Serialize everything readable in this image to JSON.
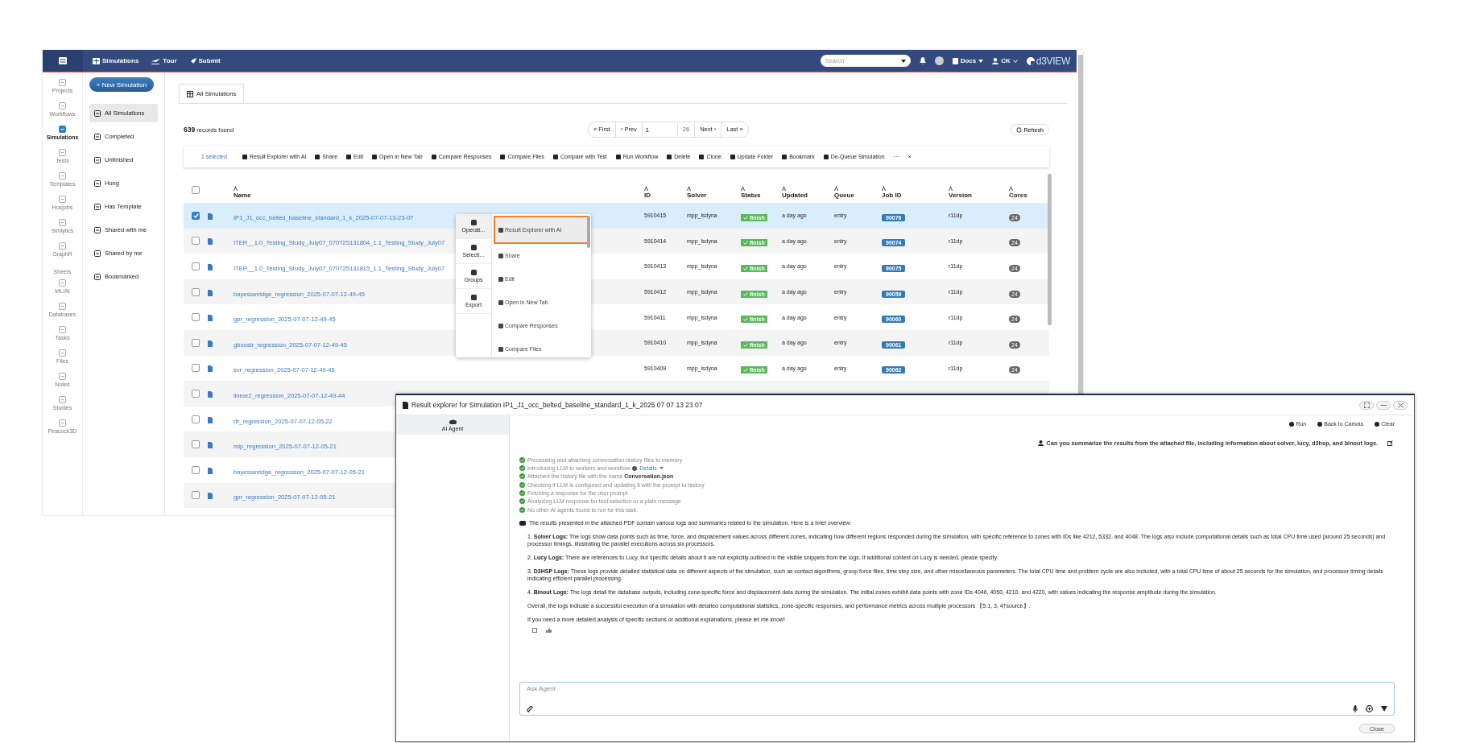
{
  "navbar": {
    "items": [
      {
        "label": "Simulations"
      },
      {
        "label": "Tour"
      },
      {
        "label": "Submit"
      }
    ],
    "search": {
      "placeholder": "Search"
    },
    "docs": "Docs",
    "user": "CK",
    "logo": "d3VIEW"
  },
  "rail": {
    "groups": [
      {
        "items": [
          {
            "label": "Projects",
            "selected": false
          },
          {
            "label": "Workflows",
            "selected": false
          },
          {
            "label": "Simulations",
            "selected": true
          },
          {
            "label": "Tests",
            "selected": false
          },
          {
            "label": "Templates",
            "selected": false
          },
          {
            "label": "Hocjobs",
            "selected": false
          },
          {
            "label": "Simlytics",
            "selected": false
          },
          {
            "label": "GraphR",
            "selected": false
          }
        ]
      },
      {
        "heading": "Sheets",
        "items": [
          {
            "label": "ML/AI",
            "selected": false
          },
          {
            "label": "Databases",
            "selected": false
          },
          {
            "label": "Tasks",
            "selected": false
          },
          {
            "label": "Files",
            "selected": false
          },
          {
            "label": "Notes",
            "selected": false
          },
          {
            "label": "Studies",
            "selected": false
          },
          {
            "label": "Peacock3D",
            "selected": false
          }
        ]
      }
    ]
  },
  "sidebar": {
    "new_button": "+ New Simulation",
    "items": [
      {
        "label": "All Simulations",
        "selected": true
      },
      {
        "label": "Completed",
        "selected": false
      },
      {
        "label": "Unfinished",
        "selected": false
      },
      {
        "label": "Hung",
        "selected": false
      },
      {
        "label": "Has Template",
        "selected": false
      },
      {
        "label": "Shared with me",
        "selected": false
      },
      {
        "label": "Shared by me",
        "selected": false
      },
      {
        "label": "Bookmarked",
        "selected": false
      }
    ]
  },
  "main": {
    "tab": {
      "label": "All Simulations",
      "selected": true
    },
    "records": {
      "count": "639",
      "label": "records found"
    },
    "pagination": {
      "first": "« First",
      "prev": "‹ Prev",
      "page": "1",
      "total": "26",
      "next": "Next ›",
      "last": "Last »"
    },
    "refresh": "Refresh"
  },
  "toolbar": {
    "selected_count": "1 selected",
    "actions": [
      "Result Explorer with AI",
      "Share",
      "Edit",
      "Open in New Tab",
      "Compare Responses",
      "Compare Files",
      "Compare with Test",
      "Run Workflow",
      "Delete",
      "Clone",
      "Update Folder",
      "Bookmark",
      "De-Queue Simulation"
    ],
    "more": "···",
    "close": "×"
  },
  "table": {
    "select_all": {
      "checked": false
    },
    "columns": [
      "Name",
      "ID",
      "Solver",
      "Status",
      "Updated",
      "Queue",
      "Job ID",
      "Version",
      "Cores"
    ],
    "rows": [
      {
        "selected": true,
        "name": "IP1_J1_occ_belted_baseline_standard_1_k_2025-07-07-13-23-07",
        "id": "5910415",
        "solver": "mpp_lsdyna",
        "status": "finish",
        "updated": "a day ago",
        "queue": "entry",
        "job_id": "90076",
        "version": "r11dp",
        "cores": "24"
      },
      {
        "selected": false,
        "name": "ITER__1.0_Testing_Study_July07_070725131804_1.1_Testing_Study_July07",
        "id": "5910414",
        "solver": "mpp_lsdyna",
        "status": "finish",
        "updated": "a day ago",
        "queue": "entry",
        "job_id": "90074",
        "version": "r11dp",
        "cores": "24"
      },
      {
        "selected": false,
        "name": "ITER__1.0_Testing_Study_July07_070725131815_1.1_Testing_Study_July07",
        "id": "5910413",
        "solver": "mpp_lsdyna",
        "status": "finish",
        "updated": "a day ago",
        "queue": "entry",
        "job_id": "90075",
        "version": "r11dp",
        "cores": "24"
      },
      {
        "selected": false,
        "name": "bayesianridge_regression_2025-07-07-12-49-45",
        "id": "5910412",
        "solver": "mpp_lsdyna",
        "status": "finish",
        "updated": "a day ago",
        "queue": "entry",
        "job_id": "90059",
        "version": "r11dp",
        "cores": "24"
      },
      {
        "selected": false,
        "name": "gpr_regression_2025-07-07-12-49-45",
        "id": "5910411",
        "solver": "mpp_lsdyna",
        "status": "finish",
        "updated": "a day ago",
        "queue": "entry",
        "job_id": "90060",
        "version": "r11dp",
        "cores": "24"
      },
      {
        "selected": false,
        "name": "gboostr_regression_2025-07-07-12-49-45",
        "id": "5910410",
        "solver": "mpp_lsdyna",
        "status": "finish",
        "updated": "a day ago",
        "queue": "entry",
        "job_id": "90061",
        "version": "r11dp",
        "cores": "24"
      },
      {
        "selected": false,
        "name": "svr_regression_2025-07-07-12-49-45",
        "id": "5910409",
        "solver": "mpp_lsdyna",
        "status": "finish",
        "updated": "a day ago",
        "queue": "entry",
        "job_id": "90062",
        "version": "r11dp",
        "cores": "24"
      },
      {
        "selected": false,
        "name": "linear2_regression_2025-07-07-12-49-44"
      },
      {
        "selected": false,
        "name": "rfr_regression_2025-07-07-12-05-22"
      },
      {
        "selected": false,
        "name": "mlp_regression_2025-07-07-12-05-21"
      },
      {
        "selected": false,
        "name": "bayesianridge_regression_2025-07-07-12-05-21"
      },
      {
        "selected": false,
        "name": "gpr_regression_2025-07-07-12-05-21"
      }
    ]
  },
  "context_menu": {
    "sections": [
      {
        "label": "Operati...",
        "selected": true
      },
      {
        "label": "Selecti...",
        "selected": false
      },
      {
        "label": "Groups",
        "selected": false
      },
      {
        "label": "Export",
        "selected": false
      }
    ],
    "items": [
      {
        "label": "Result Explorer with AI",
        "selected": true
      },
      {
        "label": "Share",
        "selected": false
      },
      {
        "label": "Edit",
        "selected": false
      },
      {
        "label": "Open in New Tab",
        "selected": false
      },
      {
        "label": "Compare Responses",
        "selected": false
      },
      {
        "label": "Compare Files",
        "selected": false
      }
    ]
  },
  "dialog": {
    "title": "Result explorer for Simulation IP1_J1_occ_belted_baseline_standard_1_k_2025 07 07 13 23 07",
    "tabs": [
      {
        "label": "AI Agent",
        "selected": true
      }
    ],
    "actions": [
      "Run",
      "Back to Canvas",
      "Clear"
    ],
    "user_message": "Can you summarize the results from the attached file, including information about solver, lucy, d3hsp, and binout logs.",
    "steps": [
      {
        "text": "Processing and attaching conversation history files to memory",
        "done": true
      },
      {
        "text": "Introducing LLM to workers and workflow",
        "done": true,
        "details": "Details"
      },
      {
        "text": "Attached the history file with the name **Conversation.json**",
        "done": true
      },
      {
        "text": "Checking if LLM is configured and updating it with the prompt to history",
        "done": true
      },
      {
        "text": "Fetching a response for the user prompt",
        "done": true
      },
      {
        "text": "Analyzing LLM response for tool selection or a plain message",
        "done": true
      },
      {
        "text": "No other AI agents found to run for this task.",
        "done": true
      }
    ],
    "answer": {
      "intro": "The results presented in the attached PDF contain various logs and summaries related to the simulation. Here is a brief overview:",
      "items": [
        "1. **Solver Logs:** The logs show data points such as time, force, and displacement values across different zones, indicating how different regions responded during the simulation, with specific reference to zones with IDs like 4212, 5332, and 4048. The logs also include computational details such as total CPU time used (around 25 seconds) and processor timings, illustrating the parallel executions across six processors.",
        "2. **Lucy Logs:** There are references to Lucy, but specific details about it are not explicitly outlined in the visible snippets from the logs. If additional context on Lucy is needed, please specify.",
        "3. **D3HSP Logs:** These logs provide detailed statistical data on different aspects of the simulation, such as contact algorithms, group force files, time step size, and other miscellaneous parameters. The total CPU time and problem cycle are also included, with a total CPU time of about 25 seconds for the simulation, and processor timing details indicating efficient parallel processing.",
        "4. **Binout Logs:** The logs detail the database outputs, including zone-specific force and displacement data during the simulation. The initial zones exhibit data points with zone IDs 4046, 4050, 4210, and 4220, with values indicating the response amplitude during the simulation."
      ],
      "closing": [
        "Overall, the logs indicate a successful execution of a simulation with detailed computational statistics, zone-specific responses, and performance metrics across multiple processors 【5:1, 3, 4†source】.",
        "If you need a more detailed analysis of specific sections or additional explanations, please let me know!"
      ]
    },
    "input": {
      "placeholder": "Ask Agent"
    },
    "close": "Close"
  }
}
